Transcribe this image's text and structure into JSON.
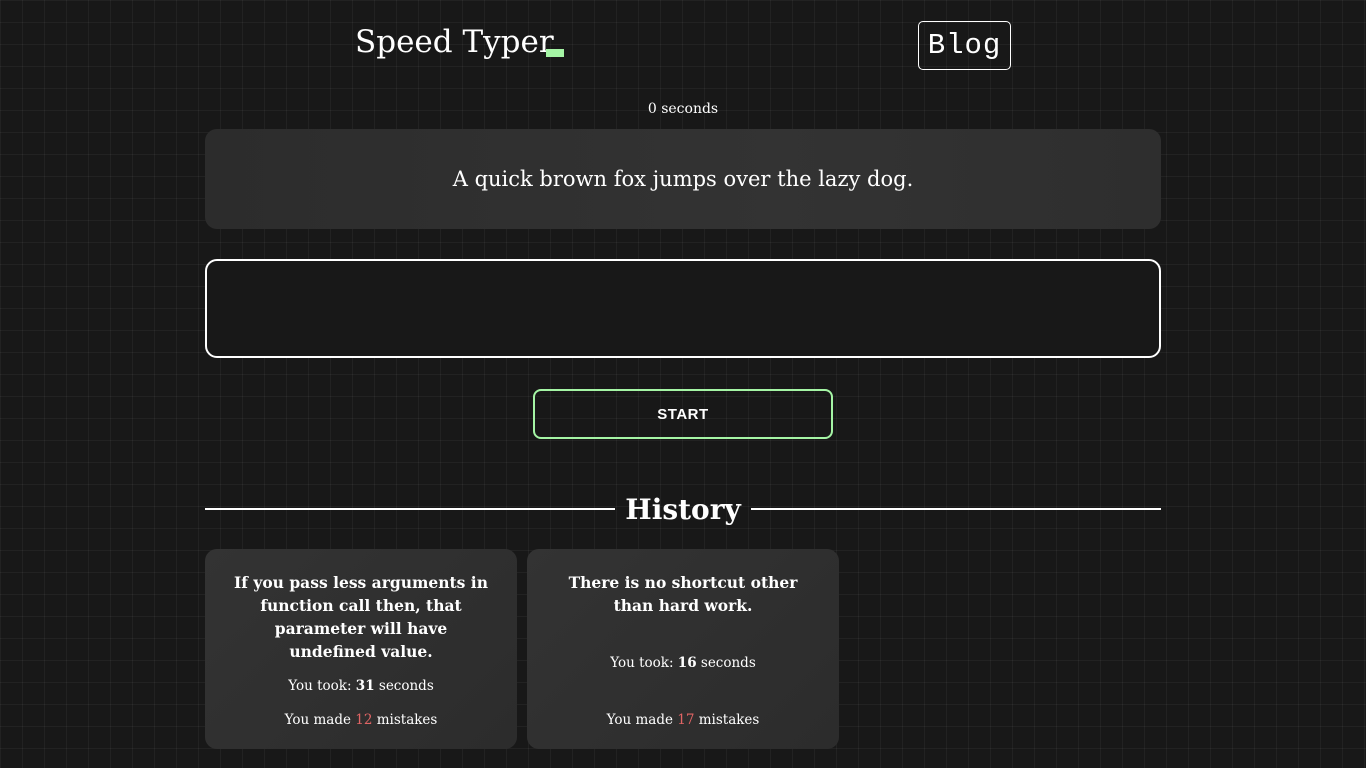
{
  "header": {
    "logo_text": "Speed Typer",
    "blog_label": "Blog",
    "accent_color": "#a5f5a5"
  },
  "timer": {
    "text": "0 seconds"
  },
  "quote": {
    "text": "A quick brown fox jumps over the lazy dog."
  },
  "typing_input": {
    "value": "",
    "placeholder": ""
  },
  "start_button": {
    "label": "START"
  },
  "history": {
    "title": "History",
    "mistake_color": "#e06464",
    "items": [
      {
        "quote": "If you pass less arguments in function call then, that parameter will have undefined value.",
        "took_prefix": "You took: ",
        "seconds": "31",
        "took_suffix": " seconds",
        "mistakes_prefix": "You made ",
        "mistakes": "12",
        "mistakes_suffix": " mistakes"
      },
      {
        "quote": "There is no shortcut other than hard work.",
        "took_prefix": "You took: ",
        "seconds": "16",
        "took_suffix": " seconds",
        "mistakes_prefix": "You made ",
        "mistakes": "17",
        "mistakes_suffix": " mistakes"
      }
    ]
  }
}
